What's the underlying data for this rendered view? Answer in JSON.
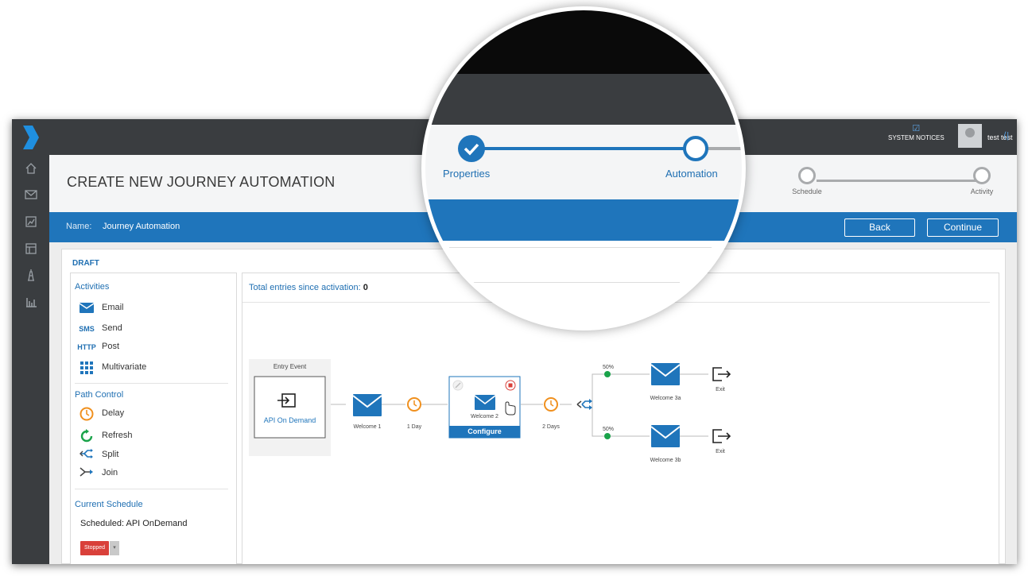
{
  "topbar": {
    "system_notices_label": "SYSTEM NOTICES",
    "user_name": "test test"
  },
  "header": {
    "title": "CREATE NEW JOURNEY AUTOMATION",
    "steps": [
      {
        "label": "Properties",
        "state": "complete"
      },
      {
        "label": "Automation",
        "state": "current"
      },
      {
        "label": "Schedule",
        "state": "pending"
      },
      {
        "label": "Activity",
        "state": "pending"
      }
    ]
  },
  "namebar": {
    "label": "Name:",
    "value": "Journey Automation",
    "back_label": "Back",
    "continue_label": "Continue"
  },
  "status": "DRAFT",
  "sidebar": {
    "activities_title": "Activities",
    "activities": [
      {
        "icon": "email-icon",
        "glyph": "",
        "label": "Email"
      },
      {
        "icon": "sms-icon",
        "glyph": "SMS",
        "label": "Send"
      },
      {
        "icon": "http-icon",
        "glyph": "HTTP",
        "label": "Post"
      },
      {
        "icon": "multivariate-icon",
        "glyph": "",
        "label": "Multivariate"
      }
    ],
    "path_title": "Path Control",
    "path_items": [
      {
        "icon": "clock-icon",
        "label": "Delay"
      },
      {
        "icon": "refresh-icon",
        "label": "Refresh"
      },
      {
        "icon": "split-icon",
        "label": "Split"
      },
      {
        "icon": "join-icon",
        "label": "Join"
      }
    ],
    "schedule_title": "Current Schedule",
    "schedule_text": "Scheduled: API OnDemand",
    "schedule_status": "Stopped"
  },
  "canvas": {
    "entries_label": "Total entries since activation:",
    "entries_value": "0",
    "entry_event_title": "Entry Event",
    "entry_event_label": "API On Demand",
    "nodes": {
      "welcome1": "Welcome 1",
      "delay1": "1 Day",
      "welcome2": "Welcome 2",
      "configure": "Configure",
      "delay2": "2 Days",
      "split_a": "50%",
      "split_b": "50%",
      "welcome3a": "Welcome 3a",
      "welcome3b": "Welcome 3b",
      "exit_a": "Exit",
      "exit_b": "Exit"
    }
  },
  "colors": {
    "brand_blue": "#1f75bb",
    "dark_bar": "#3a3d40",
    "delay_orange": "#f0901e",
    "split_green": "#1aa34a",
    "stopped_red": "#d9403a"
  }
}
